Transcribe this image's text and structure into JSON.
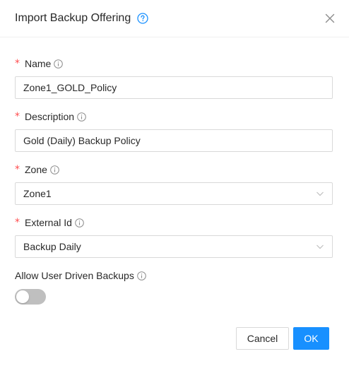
{
  "dialog": {
    "title": "Import Backup Offering"
  },
  "fields": {
    "name": {
      "label": "Name",
      "value": "Zone1_GOLD_Policy",
      "required": "*"
    },
    "description": {
      "label": "Description",
      "value": "Gold (Daily) Backup Policy",
      "required": "*"
    },
    "zone": {
      "label": "Zone",
      "value": "Zone1",
      "required": "*"
    },
    "external_id": {
      "label": "External Id",
      "value": "Backup Daily",
      "required": "*"
    },
    "allow_user_driven": {
      "label": "Allow User Driven Backups",
      "checked": false
    }
  },
  "footer": {
    "cancel_label": "Cancel",
    "ok_label": "OK"
  },
  "colors": {
    "primary": "#1890ff",
    "required": "#ff4d4f",
    "switch_off": "#bfbfbf"
  },
  "icons": [
    "question-circle-icon",
    "close-icon",
    "info-circle-icon",
    "chevron-down-icon"
  ]
}
